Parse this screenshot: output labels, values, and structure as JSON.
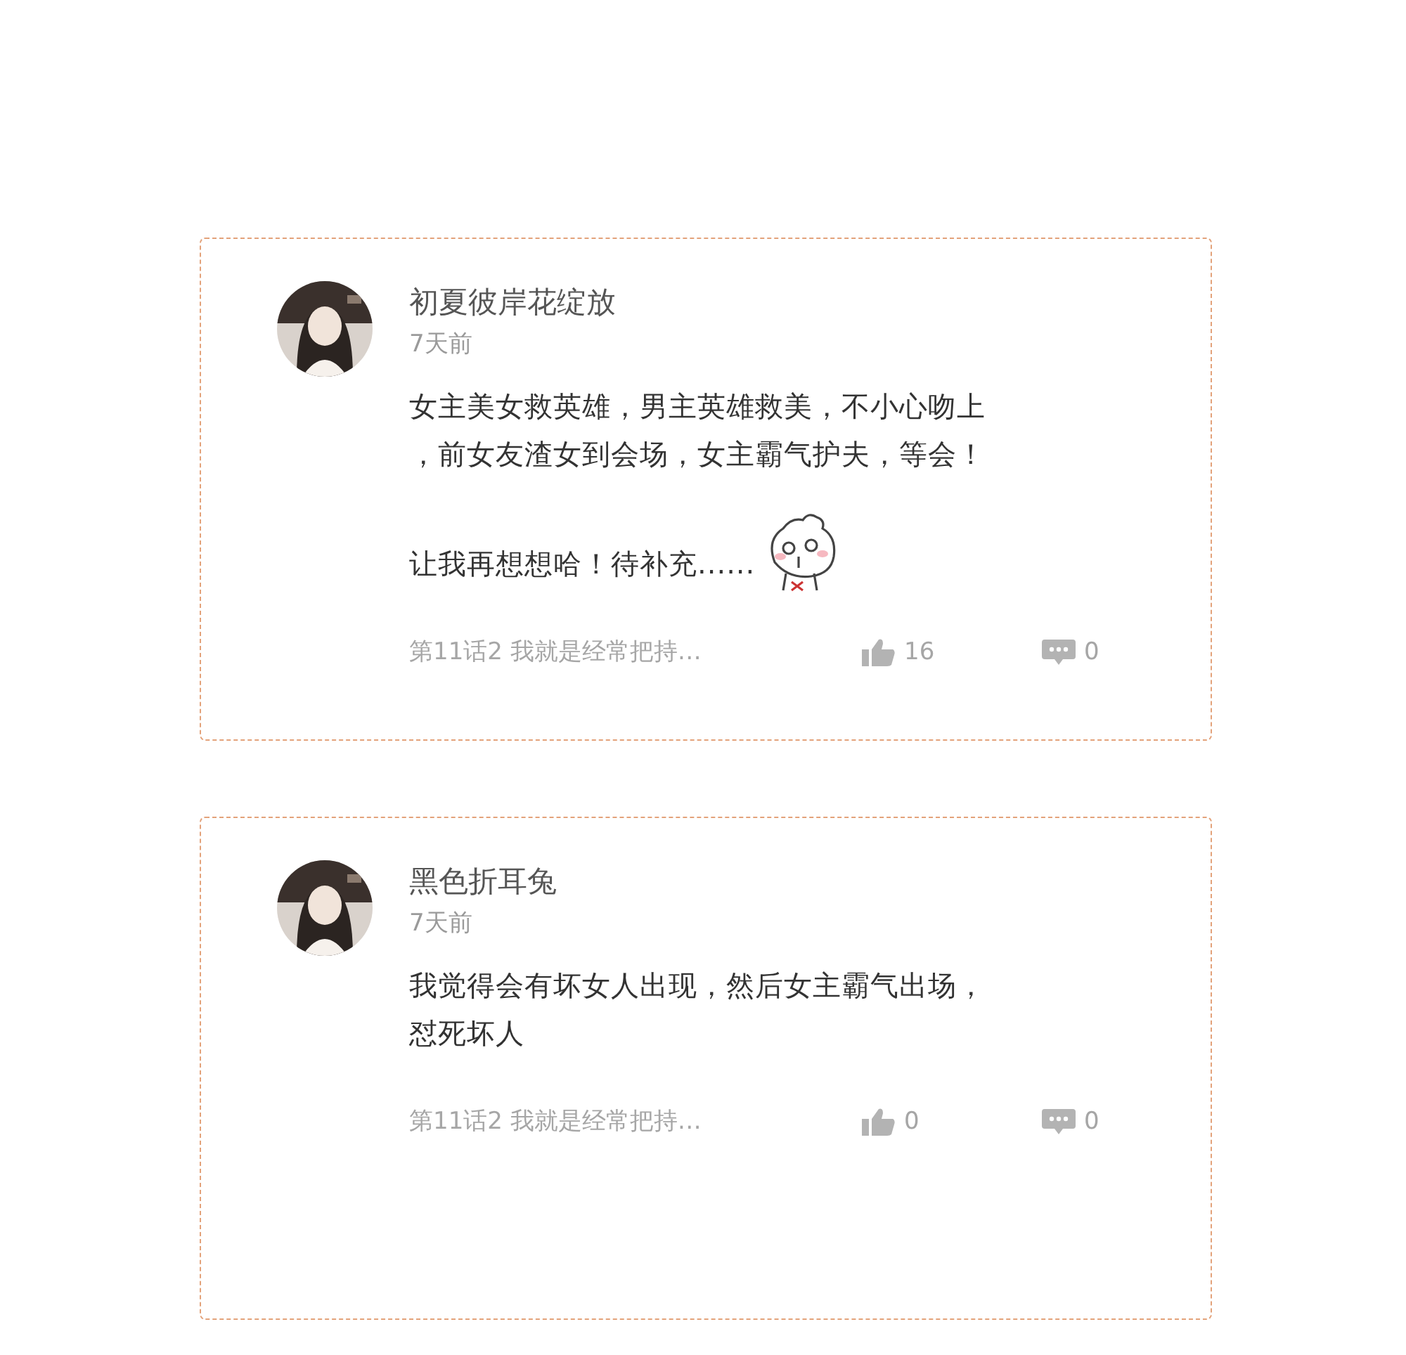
{
  "comments": [
    {
      "user": "初夏彼岸花绽放",
      "time": "7天前",
      "paragraphs": [
        [
          "女主美女救英雄，男主英雄救美，不小心吻上",
          "，前女友渣女到会场，女主霸气护夫，等会！"
        ],
        [
          "让我再想想哈！待补充......"
        ]
      ],
      "sticker": true,
      "chapter": "第11话2 我就是经常把持…",
      "likes": "16",
      "replies": "0"
    },
    {
      "user": "黑色折耳兔",
      "time": "7天前",
      "paragraphs": [
        [
          "我觉得会有坏女人出现，然后女主霸气出场，",
          "怼死坏人"
        ]
      ],
      "sticker": false,
      "chapter": "第11话2 我就是经常把持…",
      "likes": "0",
      "replies": "0"
    }
  ]
}
